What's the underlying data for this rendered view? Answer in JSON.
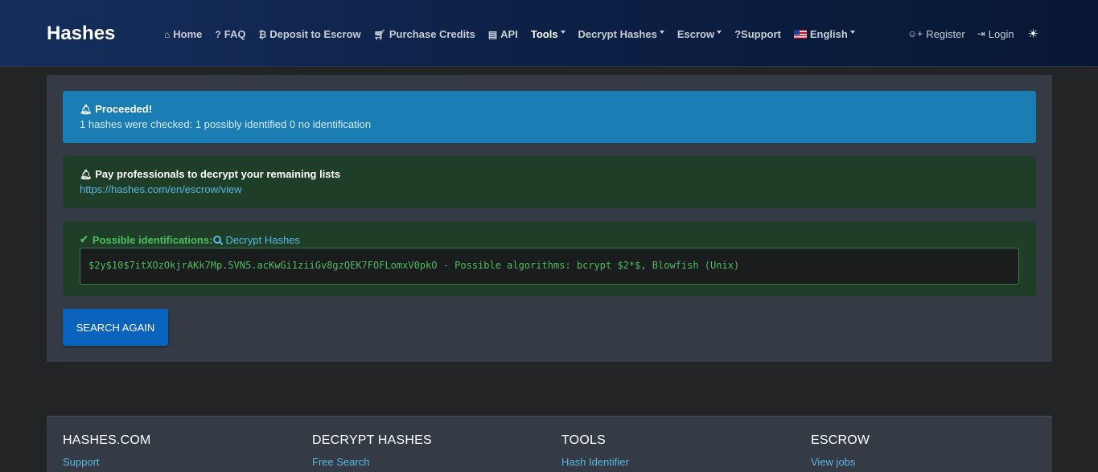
{
  "brand": "Hashes",
  "nav": {
    "home": "Home",
    "faq": "FAQ",
    "deposit": "Deposit to Escrow",
    "purchase": "Purchase Credits",
    "api": "API",
    "tools": "Tools",
    "decrypt": "Decrypt Hashes",
    "escrow": "Escrow",
    "support": "?Support",
    "language": "English",
    "register": "Register",
    "login": "Login"
  },
  "icons": {
    "home": "home-icon",
    "faq": "question-icon",
    "deposit": "bitcoin-icon",
    "purchase": "cart-icon",
    "api": "server-icon",
    "register": "user-plus-icon",
    "login": "sign-in-icon",
    "theme": "sun-icon"
  },
  "alerts": {
    "info": {
      "title": "Proceeded!",
      "text": "1 hashes were checked: 1 possibly identified 0 no identification"
    },
    "escrow": {
      "title": "Pay professionals to decrypt your remaining lists",
      "link": "https://hashes.com/en/escrow/view"
    },
    "identifications": {
      "label": "Possible identifications:",
      "link": "Decrypt Hashes",
      "result": "$2y$10$7itXOzOkjrAKk7Mp.5VN5.acKwGi1ziiGv8gzQEK7FOFLomxV0pkO - Possible algorithms: bcrypt $2*$, Blowfish (Unix)"
    }
  },
  "search_again": "SEARCH AGAIN",
  "footer": {
    "col1": {
      "heading": "HASHES.COM",
      "link": "Support"
    },
    "col2": {
      "heading": "DECRYPT HASHES",
      "link": "Free Search"
    },
    "col3": {
      "heading": "TOOLS",
      "link": "Hash Identifier"
    },
    "col4": {
      "heading": "ESCROW",
      "link": "View jobs"
    }
  },
  "colors": {
    "navbar": "#0c1f44",
    "info": "#1a7db4",
    "success": "#1f3e28",
    "accent_green": "#4ebd60",
    "link": "#5cb6e3",
    "button": "#0b63bd"
  }
}
